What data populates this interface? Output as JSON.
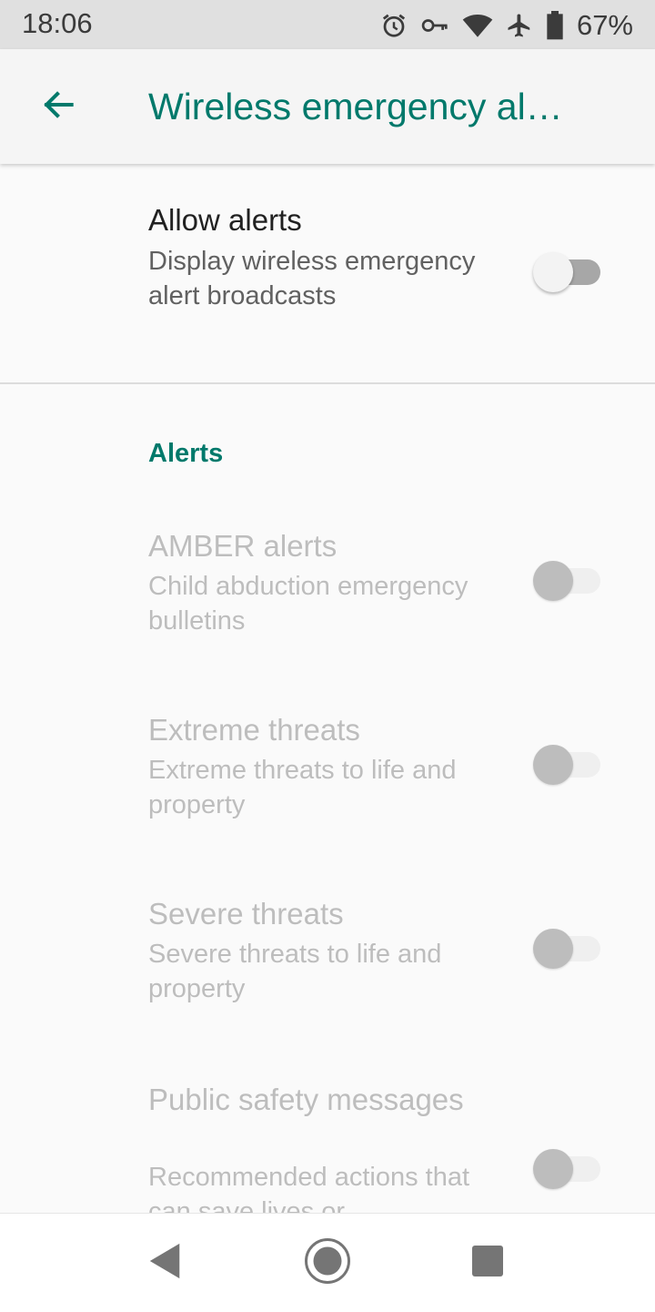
{
  "status_bar": {
    "time": "18:06",
    "battery_percent": "67%",
    "icons": [
      "alarm-icon",
      "vpn-key-icon",
      "wifi-icon",
      "airplane-icon",
      "battery-icon"
    ]
  },
  "app_bar": {
    "back_icon": "arrow-back-icon",
    "title": "Wireless emergency al…"
  },
  "allow_alerts": {
    "title": "Allow alerts",
    "summary": "Display wireless emergency alert broadcasts",
    "checked": false,
    "enabled": true
  },
  "alerts_category": {
    "title": "Alerts",
    "items": [
      {
        "title": "AMBER alerts",
        "summary": "Child abduction emergency bulletins",
        "checked": false,
        "enabled": false
      },
      {
        "title": "Extreme threats",
        "summary": "Extreme threats to life and property",
        "checked": false,
        "enabled": false
      },
      {
        "title": "Severe threats",
        "summary": "Severe threats to life and property",
        "checked": false,
        "enabled": false
      },
      {
        "title": "Public safety messages",
        "summary": "Recommended actions that can save lives or",
        "checked": false,
        "enabled": false
      }
    ]
  },
  "nav_bar": {
    "icons": [
      "nav-back-icon",
      "nav-home-icon",
      "nav-recents-icon"
    ]
  },
  "colors": {
    "accent": "#00796b",
    "status_bar_bg": "#e0e0e0",
    "app_bar_bg": "#f5f5f5",
    "background": "#fafafa"
  }
}
